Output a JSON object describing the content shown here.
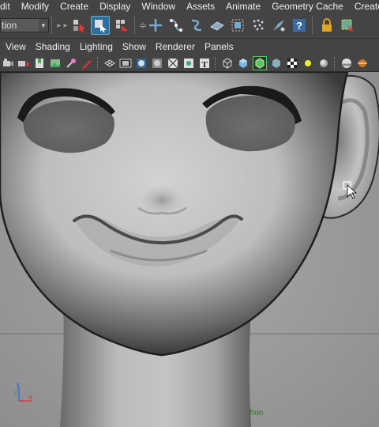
{
  "menubar": {
    "items": [
      "dit",
      "Modify",
      "Create",
      "Display",
      "Window",
      "Assets",
      "Animate",
      "Geometry Cache",
      "Create Defor"
    ]
  },
  "toolbar": {
    "mode_value": "tion"
  },
  "panel_menu": {
    "items": [
      "View",
      "Shading",
      "Lighting",
      "Show",
      "Renderer",
      "Panels"
    ]
  },
  "viewport": {
    "camera_label": "fron",
    "axis": {
      "x": "x",
      "y": "y",
      "z": "z"
    }
  },
  "colors": {
    "ui_bg": "#444444",
    "viewport_bg": "#9a9a9a",
    "accent_select": "#2f6ea0",
    "camera_label": "#1a7a1a"
  }
}
